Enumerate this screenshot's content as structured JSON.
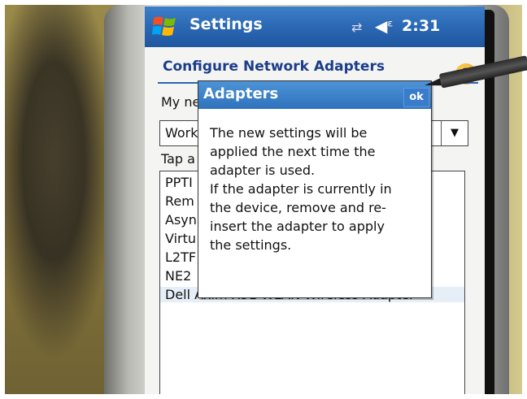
{
  "taskbar": {
    "title": "Settings",
    "time": "2:31",
    "icons": [
      "windows-start-icon",
      "connectivity-icon",
      "speaker-icon"
    ]
  },
  "page": {
    "title": "Configure Network Adapters",
    "help_icon": "?",
    "my_network_label": "My ne",
    "network_select_value": "Work",
    "tap_label": "Tap a",
    "adapters": [
      "PPTI",
      "Rem",
      "Asyn",
      "Virtu",
      "L2TF",
      "NE2",
      "Dell Axim X51 WLAN Wireless Adapter"
    ]
  },
  "dialog": {
    "title": "Adapters",
    "ok_label": "ok",
    "message_lines": [
      "The new settings will be",
      "applied the next time the",
      "adapter is used.",
      "If the adapter is currently in",
      "the device, remove and re-",
      "insert the adapter to apply",
      "the settings."
    ]
  },
  "colors": {
    "taskbar": "#2a66b2",
    "title_text": "#1c3d8a",
    "dialog_header": "#2f72bd",
    "selection": "#e6eef8"
  }
}
